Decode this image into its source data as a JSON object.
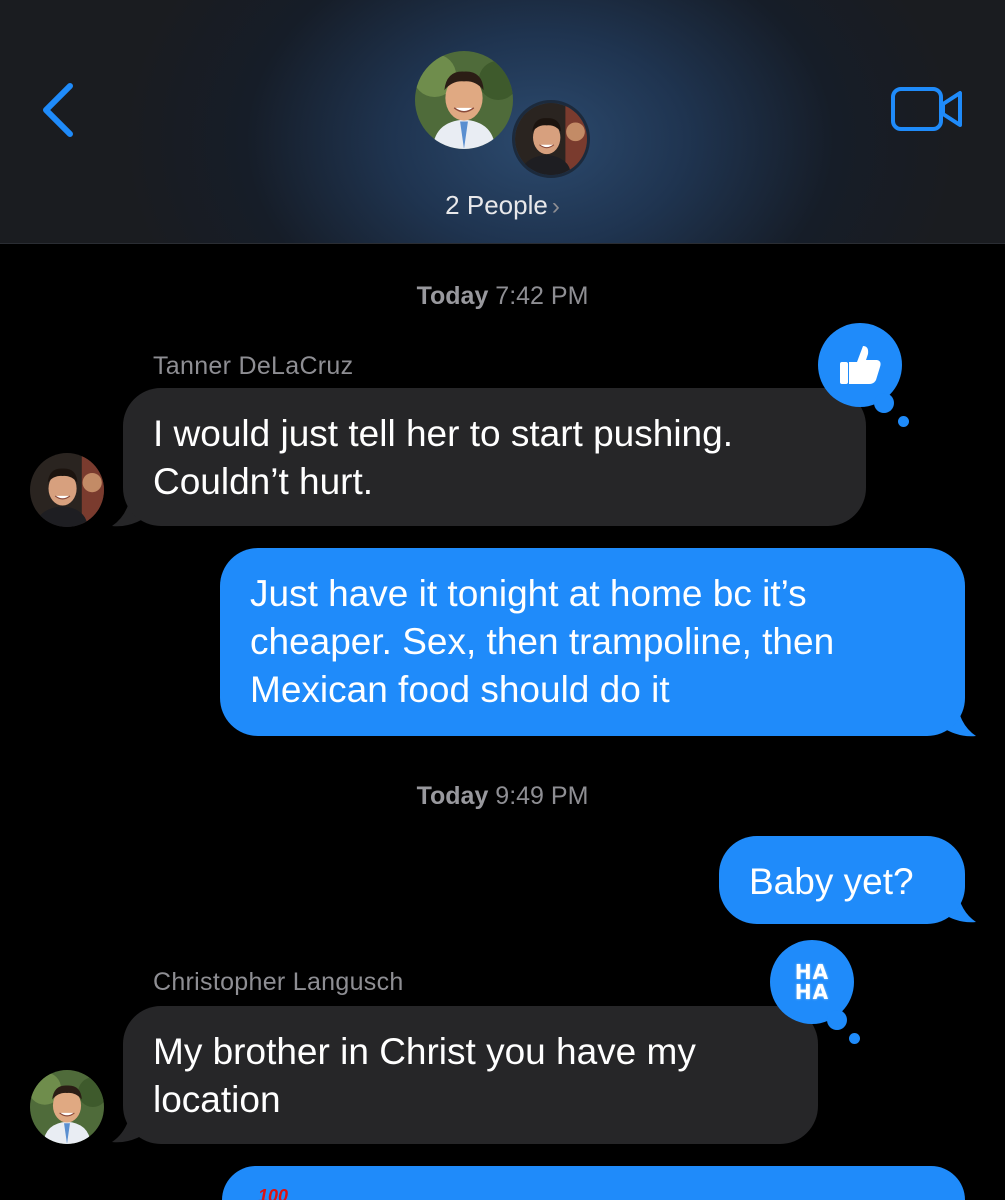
{
  "header": {
    "participants_label": "2 People",
    "back_icon": "chevron-left-icon",
    "video_icon": "video-camera-icon",
    "accent_color": "#1f8bfa"
  },
  "thread": [
    {
      "type": "timestamp",
      "day": "Today",
      "time": "7:42 PM"
    },
    {
      "type": "incoming",
      "sender": "Tanner DeLaCruz",
      "lines": [
        "I would just tell her to start pushing.",
        "Couldn’t hurt."
      ],
      "tapback": "thumbs-up-icon"
    },
    {
      "type": "outgoing",
      "lines": [
        "Just have it tonight at home bc it’s",
        "cheaper. Sex, then trampoline, then",
        "Mexican food should do it"
      ]
    },
    {
      "type": "timestamp",
      "day": "Today",
      "time": "9:49 PM"
    },
    {
      "type": "outgoing",
      "lines": [
        "Baby yet?"
      ]
    },
    {
      "type": "incoming",
      "sender": "Christopher Langusch",
      "lines": [
        "My brother in Christ you have my",
        "location"
      ],
      "tapback": "haha-icon",
      "tapback_text": [
        "HA",
        "HA"
      ]
    },
    {
      "type": "outgoing",
      "lines": [],
      "partial": true,
      "visible_glyph": "100"
    }
  ],
  "colors": {
    "incoming_bubble": "#262628",
    "outgoing_bubble": "#1f8bfa",
    "background": "#000000"
  }
}
